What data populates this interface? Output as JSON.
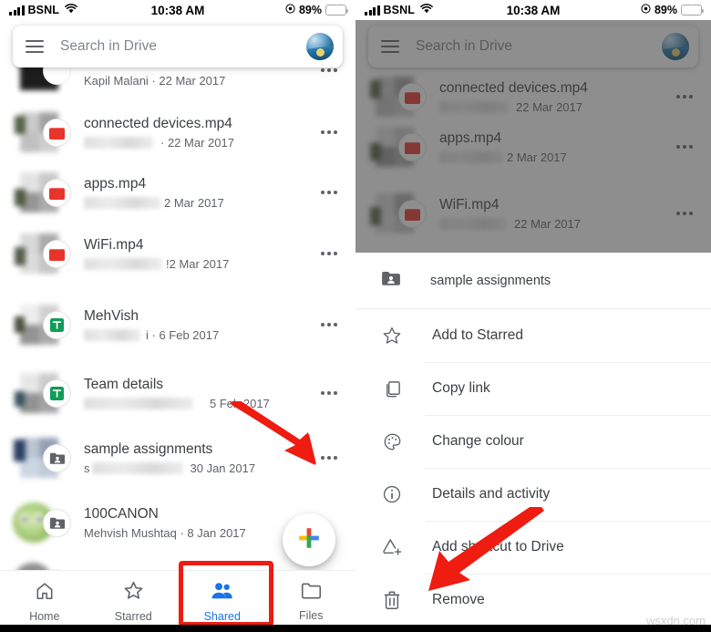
{
  "status_bar": {
    "carrier": "BSNL",
    "wifi_icon": "wifi-icon",
    "time": "10:38 AM",
    "location_icon": "location-services-icon",
    "battery_percent": "89%",
    "battery_icon": "battery-charging-icon"
  },
  "search": {
    "placeholder": "Search in Drive",
    "menu_icon": "hamburger-menu-icon",
    "avatar_icon": "account-avatar"
  },
  "colors": {
    "accent_blue": "#1a73e8",
    "annotation_red": "#ee1c11",
    "video_red": "#e8342b",
    "sheets_green": "#0f9d58",
    "folder_gray": "#5f6368",
    "text_primary": "#3c4043",
    "text_secondary": "#5f6368"
  },
  "file_list": {
    "partial_top_row": {
      "subtitle": "Kapil Malani · 22 Mar 2017"
    },
    "rows": [
      {
        "name": "connected devices.mp4",
        "owner_blurred": true,
        "date": "· 22 Mar 2017",
        "kind": "video",
        "icon": "video-clapper-icon",
        "more_icon": "overflow-menu-icon"
      },
      {
        "name": "apps.mp4",
        "owner_blurred": true,
        "date": "2 Mar 2017",
        "kind": "video",
        "icon": "video-clapper-icon",
        "more_icon": "overflow-menu-icon"
      },
      {
        "name": "WiFi.mp4",
        "owner_blurred": true,
        "date": "!2 Mar 2017",
        "kind": "video",
        "icon": "video-clapper-icon",
        "more_icon": "overflow-menu-icon"
      },
      {
        "name": "MehVish",
        "owner_blurred": true,
        "date": "i · 6 Feb 2017",
        "kind": "sheet",
        "icon": "google-sheets-icon",
        "more_icon": "overflow-menu-icon"
      },
      {
        "name": "Team details",
        "owner_blurred": true,
        "date": "5 Feb 2017",
        "kind": "sheet",
        "icon": "google-sheets-icon",
        "more_icon": "overflow-menu-icon"
      },
      {
        "name": "sample assignments",
        "owner_blurred": true,
        "date": "30 Jan 2017",
        "kind": "folder",
        "icon": "shared-folder-icon",
        "more_icon": "overflow-menu-icon"
      },
      {
        "name": "100CANON",
        "owner_blurred": false,
        "date": "Mehvish Mushtaq · 8 Jan 2017",
        "kind": "folder",
        "icon": "shared-folder-icon",
        "more_icon": "overflow-menu-icon"
      }
    ]
  },
  "fab": {
    "label": "",
    "icon": "google-plus-create-icon"
  },
  "bottom_nav": {
    "items": [
      {
        "label": "Home",
        "icon": "home-icon",
        "active": false
      },
      {
        "label": "Starred",
        "icon": "star-outline-icon",
        "active": false
      },
      {
        "label": "Shared",
        "icon": "people-shared-icon",
        "active": true
      },
      {
        "label": "Files",
        "icon": "folder-outline-icon",
        "active": false
      }
    ]
  },
  "bottom_sheet": {
    "title": "sample assignments",
    "title_icon": "shared-folder-icon",
    "items": [
      {
        "label": "Add to Starred",
        "icon": "star-outline-icon"
      },
      {
        "label": "Copy link",
        "icon": "copy-link-icon"
      },
      {
        "label": "Change colour",
        "icon": "palette-icon"
      },
      {
        "label": "Details and activity",
        "icon": "info-circle-icon"
      },
      {
        "label": "Add shortcut to Drive",
        "icon": "add-shortcut-icon"
      },
      {
        "label": "Remove",
        "icon": "trash-bin-icon"
      }
    ]
  },
  "annotations": {
    "left_arrow_target": "overflow-menu-icon for sample assignments",
    "right_arrow_target": "Remove",
    "highlight_target": "Shared"
  },
  "watermark": {
    "text": "wsxdn.com"
  }
}
